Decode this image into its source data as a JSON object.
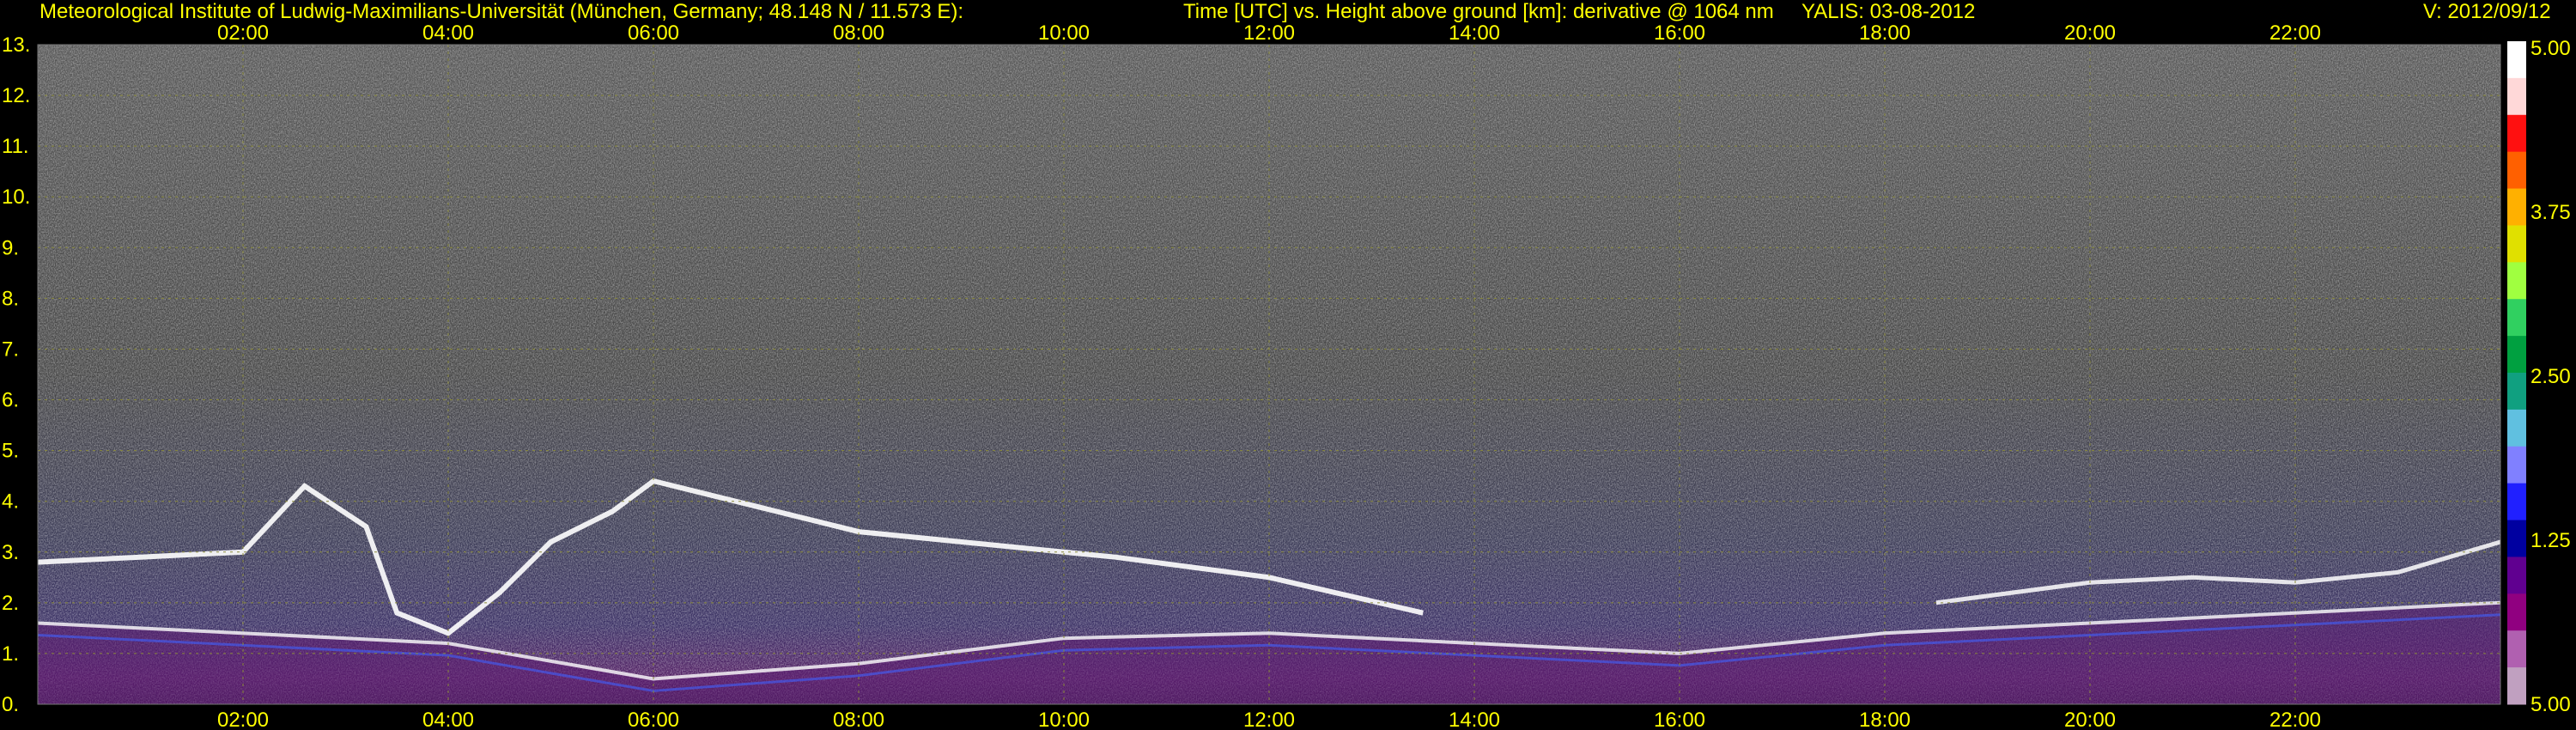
{
  "header": {
    "institute": "Meteorological Institute of Ludwig-Maximilians-Universität (München, Germany; 48.148 N / 11.573 E):",
    "axes_description": "Time [UTC] vs. Height above ground [km]: derivative @ 1064 nm",
    "instrument_date": "YALIS: 03-08-2012",
    "version": "V: 2012/09/12"
  },
  "colors": {
    "text": "#ffff00",
    "background": "#000000",
    "grid": "#8a8a3a"
  },
  "chart_data": {
    "type": "heatmap",
    "title": "Time [UTC] vs. Height above ground [km]: derivative @ 1064 nm",
    "xlabel": "",
    "ylabel": "",
    "x_ticks": [
      "02:00",
      "04:00",
      "06:00",
      "08:00",
      "10:00",
      "12:00",
      "14:00",
      "16:00",
      "18:00",
      "20:00",
      "22:00"
    ],
    "x_tick_hours": [
      2,
      4,
      6,
      8,
      10,
      12,
      14,
      16,
      18,
      20,
      22
    ],
    "xlim_hours": [
      0.0,
      24.0
    ],
    "y_ticks": [
      "0.",
      "1.",
      "2.",
      "3.",
      "4.",
      "5.",
      "6.",
      "7.",
      "8.",
      "9.",
      "10.",
      "11.",
      "12.",
      "13."
    ],
    "y_tick_values": [
      0,
      1,
      2,
      3,
      4,
      5,
      6,
      7,
      8,
      9,
      10,
      11,
      12,
      13
    ],
    "ylim": [
      0,
      13
    ],
    "grid": true,
    "colorbar": {
      "tick_labels": [
        "5.00",
        "3.75",
        "2.50",
        "1.25",
        "5.00"
      ],
      "tick_values_top_to_bottom": [
        5.0,
        3.75,
        2.5,
        1.25,
        5.0
      ],
      "colors_top_to_bottom": [
        "#ffffff",
        "#ffd8d8",
        "#ff1010",
        "#ff6000",
        "#ffb000",
        "#e0e000",
        "#a0ff40",
        "#30d060",
        "#00a040",
        "#10a080",
        "#60c0e0",
        "#8080ff",
        "#2020ff",
        "#0000a0",
        "#600090",
        "#900080",
        "#b060b0",
        "#c0a0c0"
      ]
    },
    "features": {
      "cloud_layer_km": [
        {
          "t": 0.0,
          "h": 2.8
        },
        {
          "t": 1.0,
          "h": 2.9
        },
        {
          "t": 2.0,
          "h": 3.0
        },
        {
          "t": 2.6,
          "h": 4.3
        },
        {
          "t": 3.2,
          "h": 3.5
        },
        {
          "t": 3.5,
          "h": 1.8
        },
        {
          "t": 4.0,
          "h": 1.4
        },
        {
          "t": 4.5,
          "h": 2.2
        },
        {
          "t": 5.0,
          "h": 3.2
        },
        {
          "t": 5.6,
          "h": 3.8
        },
        {
          "t": 6.0,
          "h": 4.4
        },
        {
          "t": 7.0,
          "h": 3.9
        },
        {
          "t": 8.0,
          "h": 3.4
        },
        {
          "t": 10.5,
          "h": 2.9
        },
        {
          "t": 12.0,
          "h": 2.5
        },
        {
          "t": 13.5,
          "h": 1.8
        }
      ],
      "boundary_layer_km": [
        {
          "t": 0.0,
          "h": 1.6
        },
        {
          "t": 4.0,
          "h": 1.2
        },
        {
          "t": 6.0,
          "h": 0.5
        },
        {
          "t": 8.0,
          "h": 0.8
        },
        {
          "t": 10.0,
          "h": 1.3
        },
        {
          "t": 12.0,
          "h": 1.4
        },
        {
          "t": 14.0,
          "h": 1.2
        },
        {
          "t": 16.0,
          "h": 1.0
        },
        {
          "t": 18.0,
          "h": 1.4
        },
        {
          "t": 20.0,
          "h": 1.6
        },
        {
          "t": 22.0,
          "h": 1.8
        },
        {
          "t": 24.0,
          "h": 2.0
        }
      ],
      "residual_layer_km": [
        {
          "t": 18.5,
          "h": 2.0
        },
        {
          "t": 20.0,
          "h": 2.4
        },
        {
          "t": 21.0,
          "h": 2.5
        },
        {
          "t": 22.0,
          "h": 2.4
        },
        {
          "t": 23.0,
          "h": 2.6
        },
        {
          "t": 24.0,
          "h": 3.2
        }
      ]
    }
  }
}
